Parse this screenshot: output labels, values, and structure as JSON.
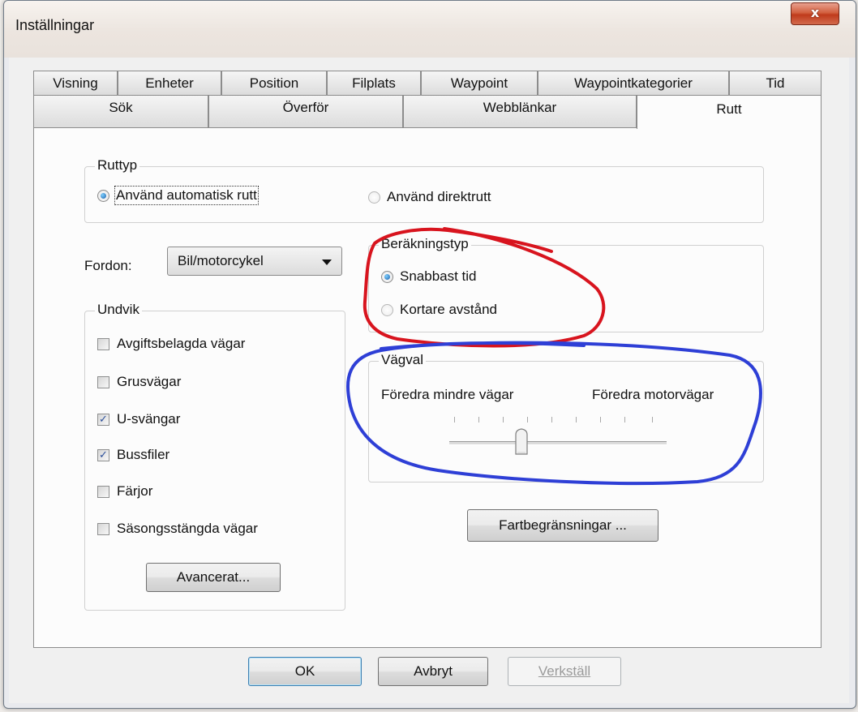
{
  "window": {
    "title": "Inställningar",
    "close_glyph": "x"
  },
  "tabs_row1": [
    "Visning",
    "Enheter",
    "Position",
    "Filplats",
    "Waypoint",
    "Waypointkategorier",
    "Tid"
  ],
  "tabs_row2": [
    "Sök",
    "Överför",
    "Webblänkar",
    "Rutt"
  ],
  "active_tab": "Rutt",
  "ruttyp": {
    "title": "Ruttyp",
    "option_auto": "Använd automatisk rutt",
    "option_direct": "Använd direktrutt",
    "selected": "Använd automatisk rutt"
  },
  "fordon": {
    "label": "Fordon:",
    "value": "Bil/motorcykel"
  },
  "berakningstyp": {
    "title": "Beräkningstyp",
    "option_fast": "Snabbast tid",
    "option_short": "Kortare avstånd",
    "selected": "Snabbast tid"
  },
  "undvik": {
    "title": "Undvik",
    "items": [
      {
        "label": "Avgiftsbelagda vägar",
        "checked": false
      },
      {
        "label": "Grusvägar",
        "checked": false
      },
      {
        "label": "U-svängar",
        "checked": true
      },
      {
        "label": "Bussfiler",
        "checked": true
      },
      {
        "label": "Färjor",
        "checked": false
      },
      {
        "label": "Säsongsstängda vägar",
        "checked": false
      }
    ],
    "advanced_button": "Avancerat..."
  },
  "vagval": {
    "title": "Vägval",
    "left_label": "Föredra mindre vägar",
    "right_label": "Föredra motorvägar",
    "tick_count": 9,
    "position_fraction": 0.375
  },
  "speed_button": "Fartbegränsningar ...",
  "footer": {
    "ok": "OK",
    "cancel": "Avbryt",
    "apply": "Verkställ"
  },
  "colors": {
    "annotation_red": "#d8141e",
    "annotation_blue": "#2e3fd6",
    "close_red": "#c9452a"
  }
}
